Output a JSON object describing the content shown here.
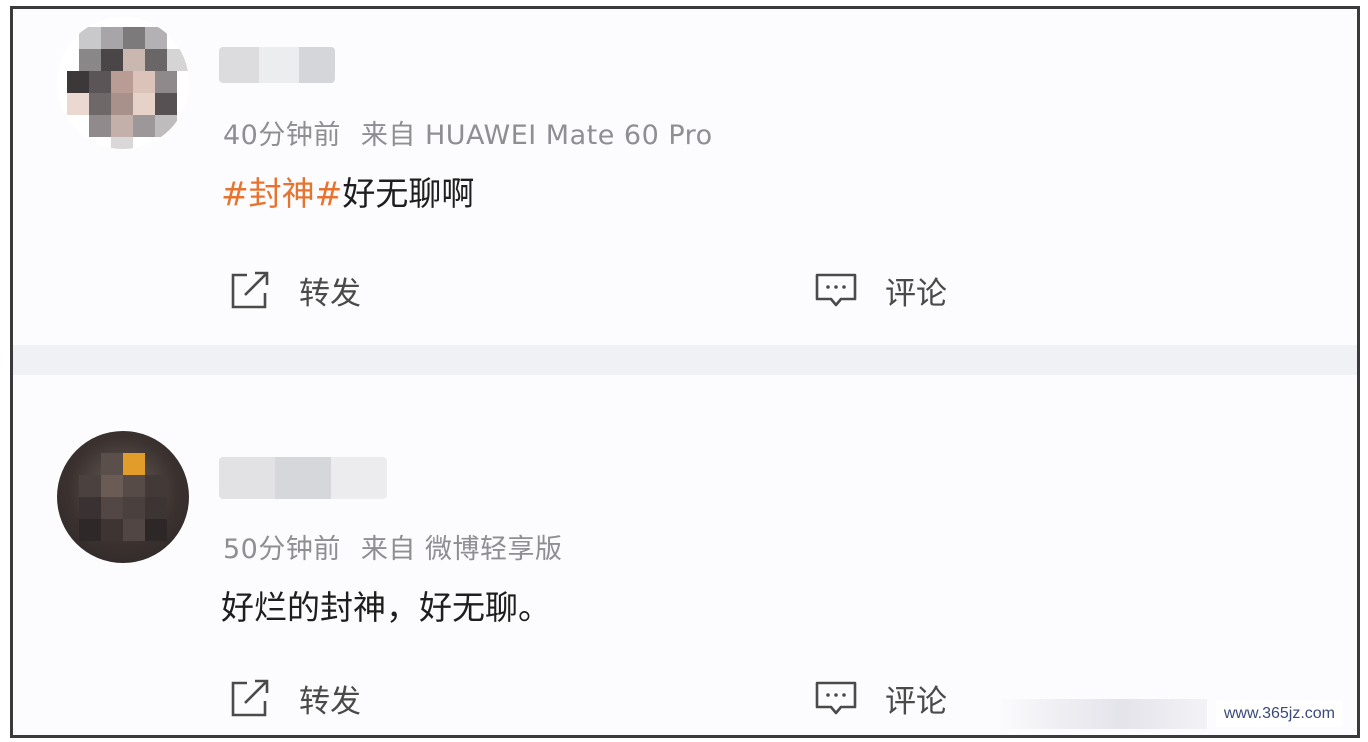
{
  "posts": [
    {
      "time": "40分钟前",
      "source": "来自 HUAWEI Mate 60 Pro",
      "hashtag": "#封神#",
      "text": "好无聊啊",
      "repost_label": "转发",
      "comment_label": "评论"
    },
    {
      "time": "50分钟前",
      "source": "来自 微博轻享版",
      "text": "好烂的封神，好无聊。",
      "repost_label": "转发",
      "comment_label": "评论"
    }
  ],
  "watermark": "www.365jz.com",
  "icons": {
    "repost": "repost-icon",
    "comment": "comment-icon"
  },
  "colors": {
    "hashtag": "#e8732f",
    "meta_text": "#8e8e93",
    "body_text": "#1e1e1e"
  }
}
